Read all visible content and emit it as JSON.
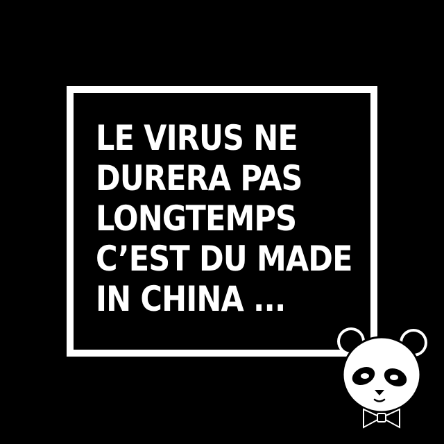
{
  "quote": {
    "lines": [
      "LE VIRUS NE",
      "DURERA PAS",
      "LONGTEMPS",
      "C’EST DU MADE",
      "IN CHINA ..."
    ]
  },
  "colors": {
    "background": "#000000",
    "text": "#ffffff",
    "frame": "#ffffff"
  },
  "mascot": {
    "icon": "panda-icon"
  }
}
